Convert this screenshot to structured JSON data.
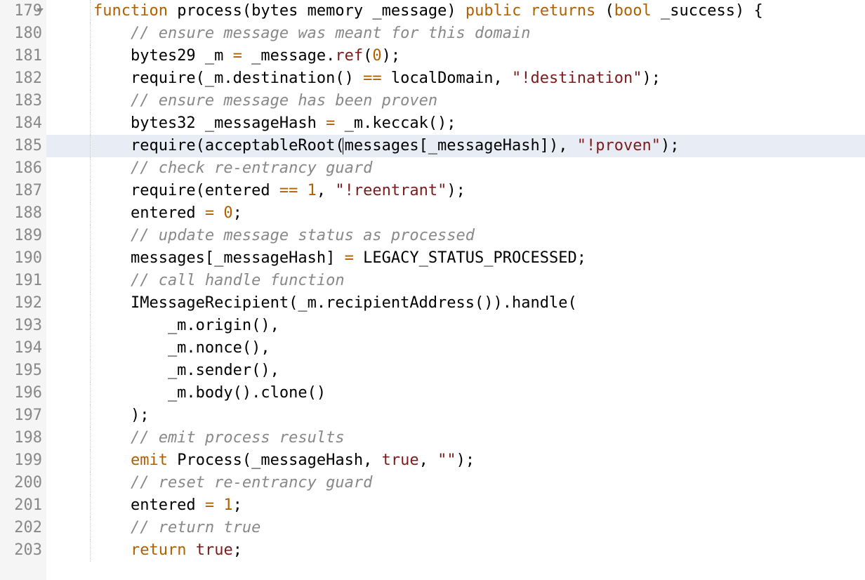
{
  "startLine": 179,
  "endLine": 203,
  "highlightedLine": 185,
  "foldLine": 179,
  "caret": {
    "line": 185,
    "col": 34
  },
  "lines": {
    "179": [
      {
        "t": "    ",
        "c": ""
      },
      {
        "t": "function",
        "c": "kw"
      },
      {
        "t": " process(",
        "c": ""
      },
      {
        "t": "bytes",
        "c": ""
      },
      {
        "t": " ",
        "c": ""
      },
      {
        "t": "memory",
        "c": ""
      },
      {
        "t": " _message) ",
        "c": ""
      },
      {
        "t": "public",
        "c": "kw2"
      },
      {
        "t": " ",
        "c": ""
      },
      {
        "t": "returns",
        "c": "kw2"
      },
      {
        "t": " (",
        "c": ""
      },
      {
        "t": "bool",
        "c": "kw"
      },
      {
        "t": " _success) {",
        "c": ""
      }
    ],
    "180": [
      {
        "t": "        ",
        "c": ""
      },
      {
        "t": "// ensure message was meant for this domain",
        "c": "cm"
      }
    ],
    "181": [
      {
        "t": "        bytes29 _m ",
        "c": ""
      },
      {
        "t": "=",
        "c": "op"
      },
      {
        "t": " _message.",
        "c": ""
      },
      {
        "t": "ref",
        "c": "ref"
      },
      {
        "t": "(",
        "c": ""
      },
      {
        "t": "0",
        "c": "num"
      },
      {
        "t": ");",
        "c": ""
      }
    ],
    "182": [
      {
        "t": "        require(_m.destination() ",
        "c": ""
      },
      {
        "t": "==",
        "c": "op"
      },
      {
        "t": " localDomain, ",
        "c": ""
      },
      {
        "t": "\"!destination\"",
        "c": "str"
      },
      {
        "t": ");",
        "c": ""
      }
    ],
    "183": [
      {
        "t": "        ",
        "c": ""
      },
      {
        "t": "// ensure message has been proven",
        "c": "cm"
      }
    ],
    "184": [
      {
        "t": "        bytes32 _messageHash ",
        "c": ""
      },
      {
        "t": "=",
        "c": "op"
      },
      {
        "t": " _m.keccak();",
        "c": ""
      }
    ],
    "185": [
      {
        "t": "        require(acceptableRoot(messages[_messageHash]), ",
        "c": ""
      },
      {
        "t": "\"!proven\"",
        "c": "str"
      },
      {
        "t": ");",
        "c": ""
      }
    ],
    "186": [
      {
        "t": "        ",
        "c": ""
      },
      {
        "t": "// check re-entrancy guard",
        "c": "cm"
      }
    ],
    "187": [
      {
        "t": "        require(entered ",
        "c": ""
      },
      {
        "t": "==",
        "c": "op"
      },
      {
        "t": " ",
        "c": ""
      },
      {
        "t": "1",
        "c": "num"
      },
      {
        "t": ", ",
        "c": ""
      },
      {
        "t": "\"!reentrant\"",
        "c": "str"
      },
      {
        "t": ");",
        "c": ""
      }
    ],
    "188": [
      {
        "t": "        entered ",
        "c": ""
      },
      {
        "t": "=",
        "c": "op"
      },
      {
        "t": " ",
        "c": ""
      },
      {
        "t": "0",
        "c": "num"
      },
      {
        "t": ";",
        "c": ""
      }
    ],
    "189": [
      {
        "t": "        ",
        "c": ""
      },
      {
        "t": "// update message status as processed",
        "c": "cm"
      }
    ],
    "190": [
      {
        "t": "        messages[_messageHash] ",
        "c": ""
      },
      {
        "t": "=",
        "c": "op"
      },
      {
        "t": " LEGACY_STATUS_PROCESSED;",
        "c": ""
      }
    ],
    "191": [
      {
        "t": "        ",
        "c": ""
      },
      {
        "t": "// call handle function",
        "c": "cm"
      }
    ],
    "192": [
      {
        "t": "        IMessageRecipient(_m.recipientAddress()).handle(",
        "c": ""
      }
    ],
    "193": [
      {
        "t": "            _m.origin(),",
        "c": ""
      }
    ],
    "194": [
      {
        "t": "            _m.nonce(),",
        "c": ""
      }
    ],
    "195": [
      {
        "t": "            _m.sender(),",
        "c": ""
      }
    ],
    "196": [
      {
        "t": "            _m.body().clone()",
        "c": ""
      }
    ],
    "197": [
      {
        "t": "        );",
        "c": ""
      }
    ],
    "198": [
      {
        "t": "        ",
        "c": ""
      },
      {
        "t": "// emit process results",
        "c": "cm"
      }
    ],
    "199": [
      {
        "t": "        ",
        "c": ""
      },
      {
        "t": "emit",
        "c": "emit"
      },
      {
        "t": " Process(_messageHash, ",
        "c": ""
      },
      {
        "t": "true",
        "c": "true"
      },
      {
        "t": ", ",
        "c": ""
      },
      {
        "t": "\"\"",
        "c": "str"
      },
      {
        "t": ");",
        "c": ""
      }
    ],
    "200": [
      {
        "t": "        ",
        "c": ""
      },
      {
        "t": "// reset re-entrancy guard",
        "c": "cm"
      }
    ],
    "201": [
      {
        "t": "        entered ",
        "c": ""
      },
      {
        "t": "=",
        "c": "op"
      },
      {
        "t": " ",
        "c": ""
      },
      {
        "t": "1",
        "c": "num"
      },
      {
        "t": ";",
        "c": ""
      }
    ],
    "202": [
      {
        "t": "        ",
        "c": ""
      },
      {
        "t": "// return true",
        "c": "cm"
      }
    ],
    "203": [
      {
        "t": "        ",
        "c": ""
      },
      {
        "t": "return",
        "c": "kw"
      },
      {
        "t": " ",
        "c": ""
      },
      {
        "t": "true",
        "c": "true"
      },
      {
        "t": ";",
        "c": ""
      }
    ]
  }
}
